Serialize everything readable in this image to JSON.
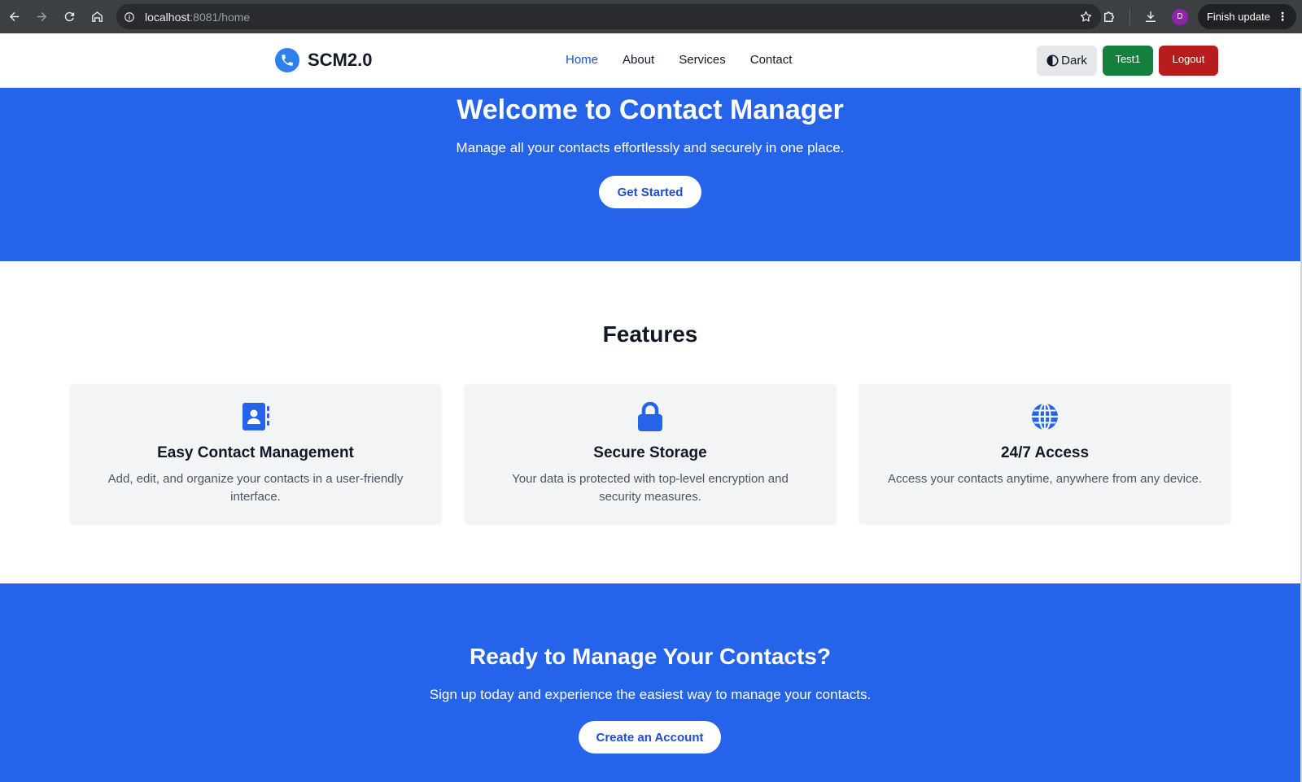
{
  "browser": {
    "url_host": "localhost",
    "url_path": ":8081/home",
    "profile_initial": "D",
    "finish_update_label": "Finish update"
  },
  "header": {
    "brand_name": "SCM2.0",
    "nav": [
      {
        "label": "Home",
        "active": true
      },
      {
        "label": "About"
      },
      {
        "label": "Services"
      },
      {
        "label": "Contact"
      }
    ],
    "theme_button_label": "Dark",
    "user_button_label": "Test1",
    "logout_button_label": "Logout"
  },
  "hero": {
    "title": "Welcome to Contact Manager",
    "subtitle": "Manage all your contacts effortlessly and securely in one place.",
    "cta_label": "Get Started"
  },
  "features": {
    "title": "Features",
    "cards": [
      {
        "icon": "address-book-icon",
        "title": "Easy Contact Management",
        "description": "Add, edit, and organize your contacts in a user-friendly interface."
      },
      {
        "icon": "lock-icon",
        "title": "Secure Storage",
        "description": "Your data is protected with top-level encryption and security measures."
      },
      {
        "icon": "globe-icon",
        "title": "24/7 Access",
        "description": "Access your contacts anytime, anywhere from any device."
      }
    ]
  },
  "cta": {
    "title": "Ready to Manage Your Contacts?",
    "subtitle": "Sign up today and experience the easiest way to manage your contacts.",
    "button_label": "Create an Account"
  },
  "colors": {
    "primary": "#2563eb",
    "user_button": "#15803d",
    "logout_button": "#b91c1c",
    "nav_active": "#1d4ed8"
  }
}
